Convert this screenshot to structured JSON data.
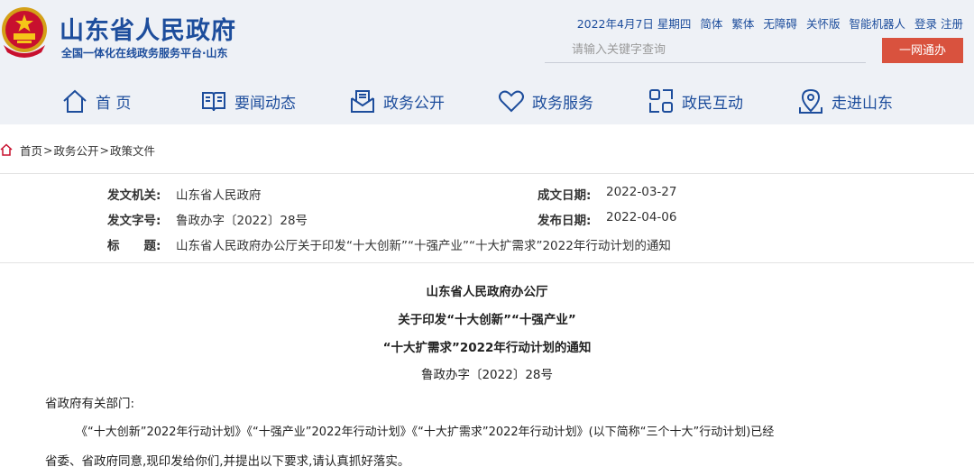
{
  "header": {
    "site_title": "山东省人民政府",
    "site_subtitle": "全国一体化在线政务服务平台·山东",
    "date": "2022年4月7日 星期四",
    "links": [
      "简体",
      "繁体",
      "无障碍",
      "关怀版",
      "智能机器人",
      "登录",
      "注册"
    ],
    "search_placeholder": "请输入关键字查询",
    "one_net_label": "一网通办"
  },
  "nav": {
    "items": [
      {
        "label": "首 页",
        "icon": "home-icon"
      },
      {
        "label": "要闻动态",
        "icon": "book-icon"
      },
      {
        "label": "政务公开",
        "icon": "mail-icon"
      },
      {
        "label": "政务服务",
        "icon": "heart-icon"
      },
      {
        "label": "政民互动",
        "icon": "interaction-icon"
      },
      {
        "label": "走进山东",
        "icon": "location-icon"
      }
    ]
  },
  "breadcrumb": [
    "首页",
    "政务公开",
    "政策文件"
  ],
  "info": {
    "issuer_label": "发文机关:",
    "issuer": "山东省人民政府",
    "doc_no_label": "发文字号:",
    "doc_no": "鲁政办字〔2022〕28号",
    "title_label": "标　　题:",
    "title": "山东省人民政府办公厅关于印发“十大创新”“十强产业”“十大扩需求”2022年行动计划的通知",
    "created_label": "成文日期:",
    "created": "2022-03-27",
    "published_label": "发布日期:",
    "published": "2022-04-06"
  },
  "document": {
    "title_lines": [
      "山东省人民政府办公厅",
      "关于印发“十大创新”“十强产业”",
      "“十大扩需求”2022年行动计划的通知"
    ],
    "doc_number": "鲁政办字〔2022〕28号",
    "salutation": "省政府有关部门:",
    "para1_line1": "《“十大创新”2022年行动计划》《“十强产业”2022年行动计划》《“十大扩需求”2022年行动计划》(以下简称“三个十大”行动计划)已经",
    "para1_line2": "省委、省政府同意,现印发给你们,并提出以下要求,请认真抓好落实。"
  },
  "colors": {
    "brand_blue": "#1d4d9c",
    "header_bg": "#eef1f6",
    "button_red": "#d9523e"
  }
}
